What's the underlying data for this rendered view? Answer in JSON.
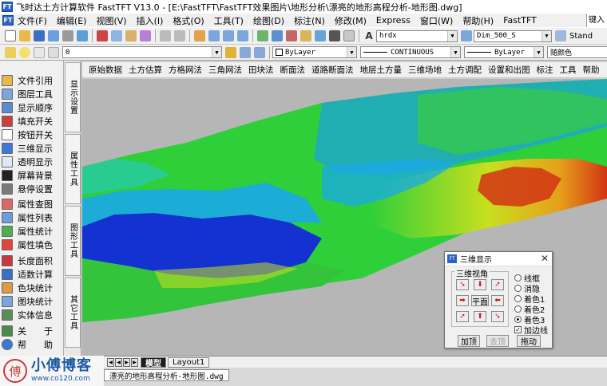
{
  "window": {
    "title": "飞时达土方计算软件 FastTFT V13.0 - [E:\\FastTFT\\FastTFT效果图片\\地形分析\\漂亮的地形高程分析-地形图.dwg]",
    "app_icon_label": "FT"
  },
  "menu": {
    "items": [
      "文件(F)",
      "编辑(E)",
      "视图(V)",
      "插入(I)",
      "格式(O)",
      "工具(T)",
      "绘图(D)",
      "标注(N)",
      "修改(M)",
      "Express",
      "窗口(W)",
      "帮助(H)",
      "FastTFT"
    ],
    "search_text": "键入"
  },
  "toolbar1": {
    "text_style": "hrdx",
    "dim_style": "Dim_500_S",
    "table_style": "Stand"
  },
  "toolbar2": {
    "layer": "0",
    "color": "ByLayer",
    "linetype": "CONTINUOUS",
    "lineweight": "ByLayer",
    "plotstyle": "随颜色"
  },
  "left_panel": {
    "items": [
      "文件引用",
      "图层工具",
      "显示顺序",
      "填充开关",
      "按钮开关",
      "三维显示",
      "透明显示",
      "屏幕背景",
      "悬停设置",
      "属性查图",
      "属性列表",
      "属性统计",
      "属性填色",
      "长度面积",
      "适数计算",
      "色块统计",
      "图块统计",
      "实体信息",
      "关　　于",
      "帮　　助"
    ]
  },
  "vertical_tabs": [
    "显示设置",
    "属性工具",
    "图形工具",
    "其它工具"
  ],
  "command_menu": [
    "原始数据",
    "土方估算",
    "方格网法",
    "三角网法",
    "田块法",
    "断面法",
    "道路断面法",
    "地层土方量",
    "三维场地",
    "土方调配",
    "设置和出图",
    "标注",
    "工具",
    "帮助"
  ],
  "layout_tabs": {
    "model": "模型",
    "layout1": "Layout1"
  },
  "file_tab": "漂亮的地形高程分析-地形图.dwg",
  "watermark": {
    "seal": "傅",
    "title": "小傅博客",
    "url": "www.co120.com"
  },
  "dialog": {
    "title": "三维显示",
    "icon_label": "FT",
    "group_label": "三维视角",
    "flat_button": "平面",
    "options": [
      "线框",
      "消隐",
      "着色1",
      "着色2",
      "着色3"
    ],
    "selected_option": "着色3",
    "checkbox_label": "加边线",
    "checkbox_checked": true,
    "buttons": {
      "add": "加顶",
      "remove": "去顶",
      "drag": "拖动"
    }
  },
  "terrain_colors": {
    "low": "#1432d2",
    "mid_low": "#1aa8e8",
    "mid": "#2fcf3a",
    "mid_high": "#e6e11c",
    "high": "#d23414"
  }
}
